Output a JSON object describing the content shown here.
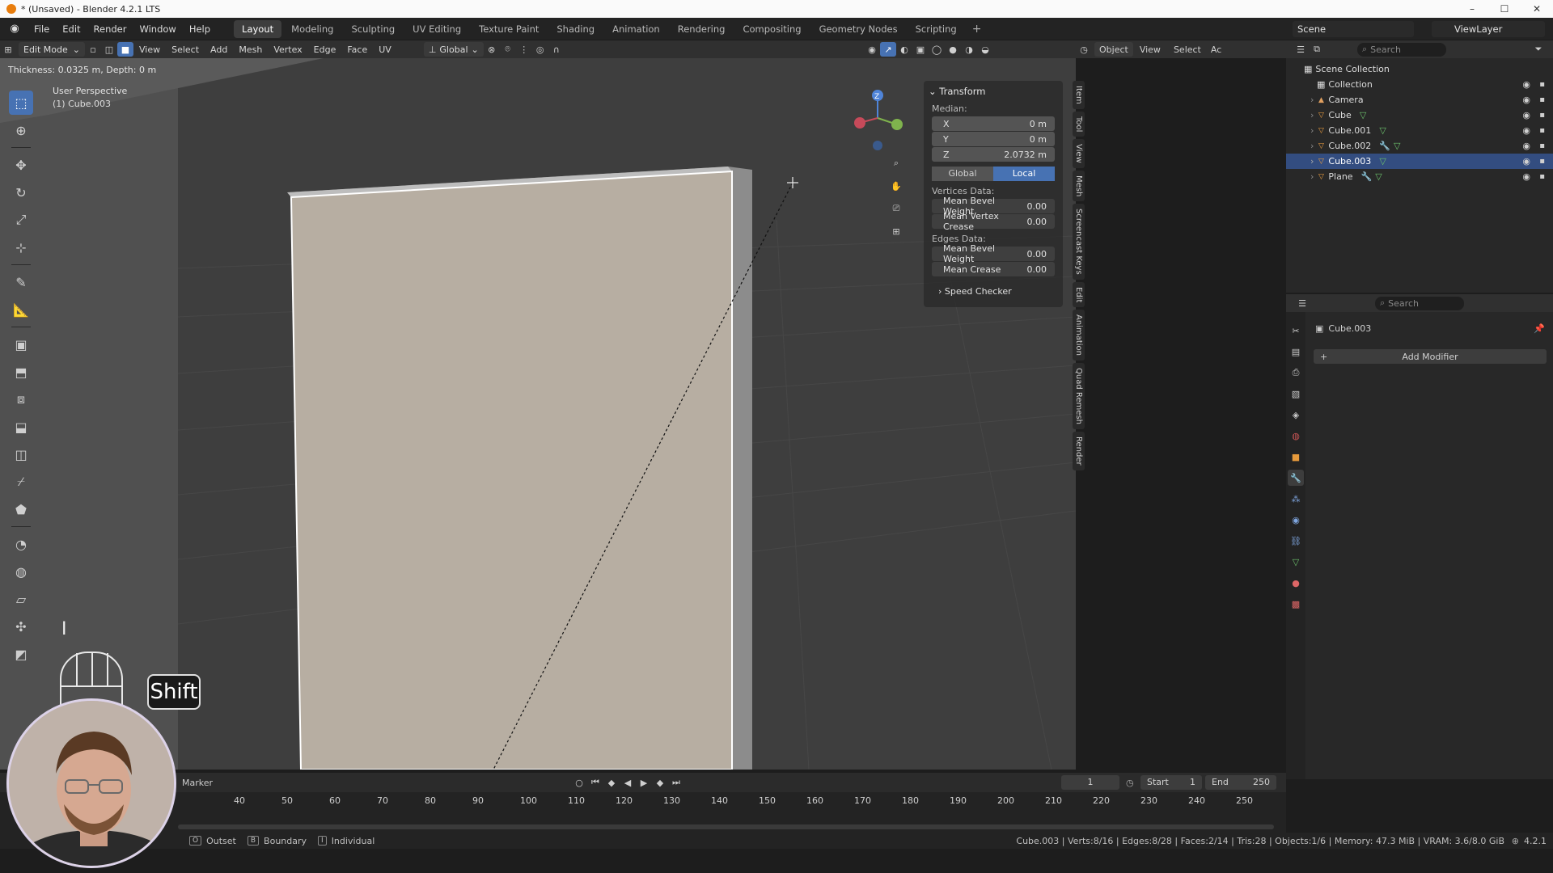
{
  "window": {
    "title": "* (Unsaved) - Blender 4.2.1 LTS"
  },
  "menu": [
    "File",
    "Edit",
    "Render",
    "Window",
    "Help"
  ],
  "workspaces": [
    {
      "label": "Layout",
      "active": true
    },
    {
      "label": "Modeling"
    },
    {
      "label": "Sculpting"
    },
    {
      "label": "UV Editing"
    },
    {
      "label": "Texture Paint"
    },
    {
      "label": "Shading"
    },
    {
      "label": "Animation"
    },
    {
      "label": "Rendering"
    },
    {
      "label": "Compositing"
    },
    {
      "label": "Geometry Nodes"
    },
    {
      "label": "Scripting"
    }
  ],
  "scene": {
    "scene_name": "Scene",
    "view_layer": "ViewLayer"
  },
  "viewport_header": {
    "mode": "Edit Mode",
    "menus": [
      "View",
      "Select",
      "Add",
      "Mesh",
      "Vertex",
      "Edge",
      "Face",
      "UV"
    ],
    "orientation": "Global",
    "object_label": "Object",
    "right_menus": [
      "View",
      "Select",
      "Ac"
    ]
  },
  "viewport": {
    "operator_status": "Thickness: 0.0325 m, Depth: 0 m",
    "perspective": "User Perspective",
    "active_object": "(1) Cube.003"
  },
  "transform_panel": {
    "title": "Transform",
    "median_label": "Median:",
    "x_label": "X",
    "x_value": "0 m",
    "y_label": "Y",
    "y_value": "0 m",
    "z_label": "Z",
    "z_value": "2.0732 m",
    "global_label": "Global",
    "local_label": "Local",
    "vertices_label": "Vertices Data:",
    "mean_bevel_weight_label": "Mean Bevel Weight",
    "mean_bevel_weight_v": "0.00",
    "mean_vertex_crease_label": "Mean Vertex Crease",
    "mean_vertex_crease_v": "0.00",
    "edges_label": "Edges Data:",
    "edge_bevel_label": "Mean Bevel Weight",
    "edge_bevel_v": "0.00",
    "mean_crease_label": "Mean Crease",
    "mean_crease_v": "0.00",
    "speed_checker": "Speed Checker"
  },
  "side_tabs": [
    "Item",
    "Tool",
    "View",
    "Mesh",
    "Screencast Keys",
    "Edit",
    "Animation",
    "Quad Remesh",
    "Render"
  ],
  "outliner": {
    "search_placeholder": "Search",
    "scene_collection": "Scene Collection",
    "collection": "Collection",
    "items": [
      {
        "name": "Camera"
      },
      {
        "name": "Cube"
      },
      {
        "name": "Cube.001"
      },
      {
        "name": "Cube.002"
      },
      {
        "name": "Cube.003",
        "selected": true
      },
      {
        "name": "Plane"
      }
    ]
  },
  "properties": {
    "search_placeholder": "Search",
    "object_name": "Cube.003",
    "add_modifier": "Add Modifier"
  },
  "timeline": {
    "marker_label": "Marker",
    "current_frame": "1",
    "start_label": "Start",
    "start_value": "1",
    "end_label": "End",
    "end_value": "250",
    "ruler": [
      "40",
      "50",
      "60",
      "70",
      "80",
      "90",
      "100",
      "110",
      "120",
      "130",
      "140",
      "150",
      "160",
      "170",
      "180",
      "190",
      "200",
      "210",
      "220",
      "230",
      "240",
      "250"
    ]
  },
  "statusbar": {
    "left_items": [
      "Outset",
      "Boundary",
      "Individual"
    ],
    "key_hints": [
      "O",
      "B",
      "I"
    ],
    "stats": "Cube.003 | Verts:8/16 | Edges:8/28 | Faces:2/14 | Tris:28 | Objects:1/6 | Memory: 47.3 MiB | VRAM: 3.6/8.0 GiB",
    "version": "4.2.1"
  },
  "screencast": {
    "key": "Shift"
  },
  "colors": {
    "accent": "#4772b3",
    "selected_row": "#334d80",
    "object_icon": "#f0a040",
    "mesh_data_icon": "#6cc06c"
  }
}
